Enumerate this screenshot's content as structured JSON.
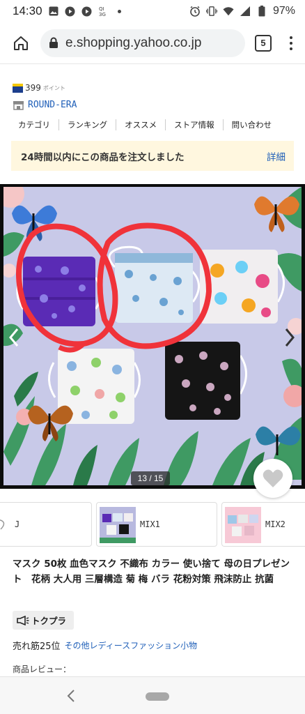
{
  "status_bar": {
    "time": "14:30",
    "battery": "97%",
    "icons_left": [
      "image-icon",
      "play-icon",
      "play-icon",
      "sim-icon"
    ],
    "icons_right": [
      "alarm-icon",
      "vibrate-icon",
      "wifi-icon",
      "signal-icon",
      "battery-icon"
    ]
  },
  "browser": {
    "url": "e.shopping.yahoo.co.jp",
    "tab_count": "5"
  },
  "store": {
    "points_value": "399",
    "points_unit": "ポイント",
    "name": "ROUND-ERA",
    "nav": [
      "カテゴリ",
      "ランキング",
      "オススメ",
      "ストア情報",
      "問い合わせ"
    ]
  },
  "order_banner": {
    "text": "24時間以内にこの商品を注文しました",
    "link": "詳細"
  },
  "gallery": {
    "counter": "13 / 15"
  },
  "variants": [
    {
      "label": "J"
    },
    {
      "label": "MIX1"
    },
    {
      "label": "MIX2"
    }
  ],
  "product": {
    "title": "マスク 50枚 血色マスク 不織布 カラー 使い捨て 母の日プレゼント　花柄 大人用 三層構造 菊 梅 バラ 花粉対策 飛沫防止 抗菌",
    "badge": "トクプラ",
    "rank_text": "売れ筋25位",
    "rank_category": "その他レディースファッション小物",
    "review_label": "商品レビュー："
  },
  "colors": {
    "link": "#1f5fb8",
    "banner_bg": "#fff7df",
    "annotation_red": "#f0333a"
  }
}
